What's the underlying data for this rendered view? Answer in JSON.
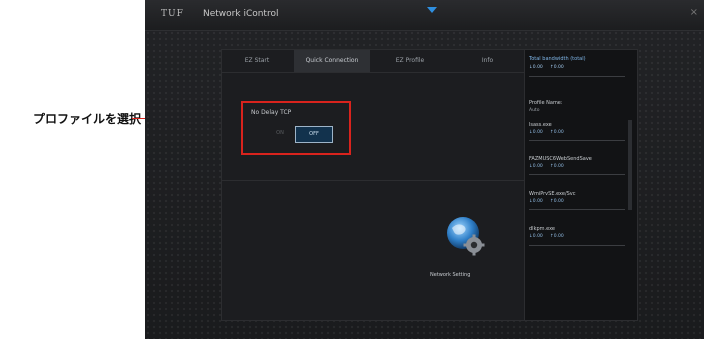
{
  "callout": {
    "label": "プロファイルを選択"
  },
  "window": {
    "logo": "TUF",
    "title": "Network iControl",
    "close": "×"
  },
  "tabs": [
    {
      "label": "EZ Start"
    },
    {
      "label": "Quick Connection",
      "active": true
    },
    {
      "label": "EZ Profile"
    },
    {
      "label": "Info"
    }
  ],
  "no_delay": {
    "title": "No Delay TCP",
    "on_label": "ON",
    "off_label": "OFF",
    "selected": "OFF"
  },
  "network_setting": {
    "label": "Network Setting"
  },
  "bandwidth": {
    "title": "Total bandwidth (total)",
    "down": "↓0.00",
    "up": "↑0.00"
  },
  "profile": {
    "title": "Profile Name:",
    "value": "Auto"
  },
  "processes": [
    {
      "name": "lsass.exe",
      "down": "↓0.00",
      "up": "↑0.00"
    },
    {
      "name": "FAZMUSC6WebSendSave",
      "down": "↓0.00",
      "up": "↑0.00"
    },
    {
      "name": "WmiPrvSE.exe/Svc",
      "down": "↓0.00",
      "up": "↑0.00"
    },
    {
      "name": "dlkpm.exe",
      "down": "↓0.00",
      "up": "↑0.00"
    }
  ],
  "colors": {
    "highlight": "#d9231d",
    "accent": "#7fb6e8",
    "background": "#1c1d20"
  }
}
